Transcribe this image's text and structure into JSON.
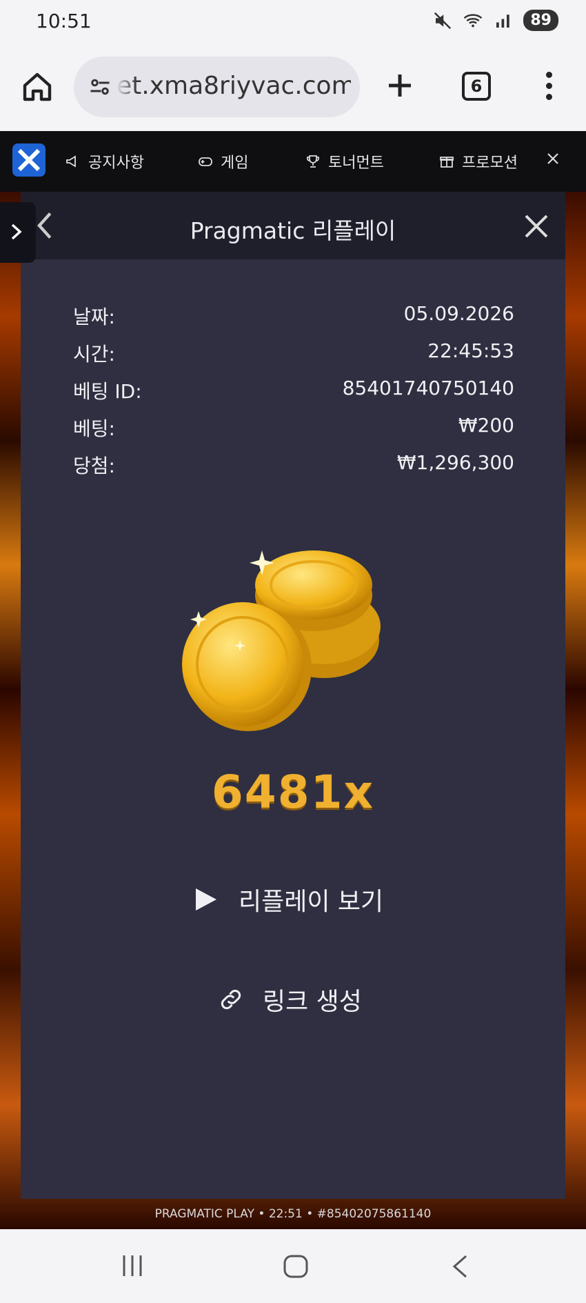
{
  "status_bar": {
    "time": "10:51",
    "battery": "89"
  },
  "browser": {
    "url": "et.xma8riyvac.com",
    "tab_count": "6"
  },
  "site_nav": {
    "items": [
      {
        "label": "공지사항",
        "icon": "megaphone-icon"
      },
      {
        "label": "게임",
        "icon": "gamepad-icon"
      },
      {
        "label": "토너먼트",
        "icon": "trophy-icon"
      },
      {
        "label": "프로모션",
        "icon": "gift-icon"
      }
    ]
  },
  "modal": {
    "title": "Pragmatic 리플레이",
    "rows": [
      {
        "label": "날짜:",
        "value": "05.09.2026"
      },
      {
        "label": "시간:",
        "value": "22:45:53"
      },
      {
        "label": "베팅 ID:",
        "value": "85401740750140"
      },
      {
        "label": "베팅:",
        "value": "₩200"
      },
      {
        "label": "당첨:",
        "value": "₩1,296,300"
      }
    ],
    "multiplier": "6481x",
    "replay_label": "리플레이 보기",
    "link_label": "링크 생성"
  },
  "game_footer": "PRAGMATIC PLAY • 22:51 • #85402075861140",
  "colors": {
    "modal_bg": "#2f2f41",
    "header_bg": "#1f1f2b",
    "accent_gold": "#f0b030"
  }
}
